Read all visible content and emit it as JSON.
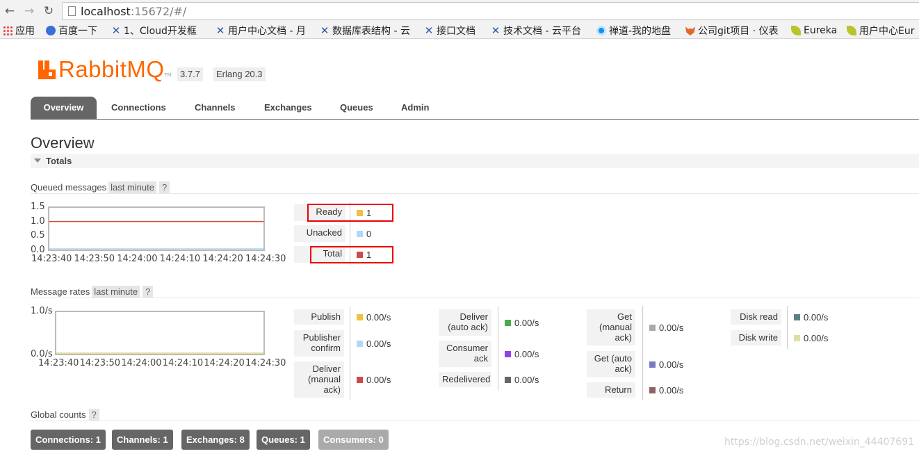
{
  "browser": {
    "url_host": "localhost",
    "url_rest": ":15672/#/",
    "bookmarks": [
      {
        "label": "应用",
        "icon": "apps-grid-icon"
      },
      {
        "label": "百度一下",
        "icon": "baidu-paw-icon"
      },
      {
        "label": "1、Cloud开发框",
        "icon": "confluence-x-icon"
      },
      {
        "label": "用户中心文档 - 月",
        "icon": "confluence-x-icon"
      },
      {
        "label": "数据库表结构 - 云",
        "icon": "confluence-x-icon"
      },
      {
        "label": "接口文档",
        "icon": "confluence-x-icon"
      },
      {
        "label": "技术文档 - 云平台",
        "icon": "confluence-x-icon"
      },
      {
        "label": "禅道-我的地盘",
        "icon": "zentao-icon"
      },
      {
        "label": "公司git项目 · 仪表",
        "icon": "gitlab-fox-icon"
      },
      {
        "label": "Eureka",
        "icon": "leaf-icon"
      },
      {
        "label": "用户中心Eur",
        "icon": "leaf-icon"
      }
    ]
  },
  "app": {
    "logo_text": "RabbitMQ",
    "logo_tm": "TM",
    "version": "3.7.7",
    "erlang": "Erlang 20.3"
  },
  "tabs": [
    "Overview",
    "Connections",
    "Channels",
    "Exchanges",
    "Queues",
    "Admin"
  ],
  "page_title": "Overview",
  "section_title": "Totals",
  "queued": {
    "heading": "Queued messages",
    "range": "last minute",
    "help": "?",
    "chart_data": {
      "type": "line",
      "x": [
        "14:23:40",
        "14:23:50",
        "14:24:00",
        "14:24:10",
        "14:24:20",
        "14:24:30"
      ],
      "ylim": [
        0,
        1.5
      ],
      "yticks": [
        "1.5",
        "1.0",
        "0.5",
        "0.0"
      ],
      "series": [
        {
          "name": "Ready",
          "color": "#edc240",
          "values": [
            1,
            1,
            1,
            1,
            1,
            1
          ]
        },
        {
          "name": "Unacked",
          "color": "#afd8f8",
          "values": [
            0,
            0,
            0,
            0,
            0,
            0
          ]
        },
        {
          "name": "Total",
          "color": "#cb4b4b",
          "values": [
            1,
            1,
            1,
            1,
            1,
            1
          ]
        }
      ]
    },
    "rows": [
      {
        "label": "Ready",
        "value": "1",
        "color": "#edc240"
      },
      {
        "label": "Unacked",
        "value": "0",
        "color": "#afd8f8"
      },
      {
        "label": "Total",
        "value": "1",
        "color": "#cb4b4b"
      }
    ]
  },
  "rates": {
    "heading": "Message rates",
    "range": "last minute",
    "help": "?",
    "chart_data": {
      "type": "line",
      "x": [
        "14:23:40",
        "14:23:50",
        "14:24:00",
        "14:24:10",
        "14:24:20",
        "14:24:30"
      ],
      "ylim": [
        0,
        1
      ],
      "yticks": [
        "1.0/s",
        "0.0/s"
      ],
      "series": [
        {
          "name": "Publish",
          "color": "#edc240",
          "values": [
            0,
            0,
            0,
            0,
            0,
            0
          ]
        },
        {
          "name": "Disk write",
          "color": "#dfe0a0",
          "values": [
            0,
            0,
            0,
            0,
            0,
            0
          ]
        }
      ]
    },
    "col1": [
      {
        "label": "Publish",
        "value": "0.00/s",
        "color": "#edc240"
      },
      {
        "label": "Publisher confirm",
        "value": "0.00/s",
        "color": "#afd8f8"
      },
      {
        "label": "Deliver (manual ack)",
        "value": "0.00/s",
        "color": "#cb4b4b"
      }
    ],
    "col2": [
      {
        "label": "Deliver (auto ack)",
        "value": "0.00/s",
        "color": "#4da74d"
      },
      {
        "label": "Consumer ack",
        "value": "0.00/s",
        "color": "#9440ed"
      },
      {
        "label": "Redelivered",
        "value": "0.00/s",
        "color": "#666666"
      }
    ],
    "col3": [
      {
        "label": "Get (manual ack)",
        "value": "0.00/s",
        "color": "#aaaaaa"
      },
      {
        "label": "Get (auto ack)",
        "value": "0.00/s",
        "color": "#7c79c3"
      },
      {
        "label": "Return",
        "value": "0.00/s",
        "color": "#8d6363"
      }
    ],
    "col4": [
      {
        "label": "Disk read",
        "value": "0.00/s",
        "color": "#607d8b"
      },
      {
        "label": "Disk write",
        "value": "0.00/s",
        "color": "#dfe0a0"
      }
    ]
  },
  "global": {
    "heading": "Global counts",
    "help": "?",
    "badges": [
      "Connections: 1",
      "Channels: 1",
      "Exchanges: 8",
      "Queues: 1",
      "Consumers: 0"
    ]
  },
  "watermark": "https://blog.csdn.net/weixin_44407691"
}
